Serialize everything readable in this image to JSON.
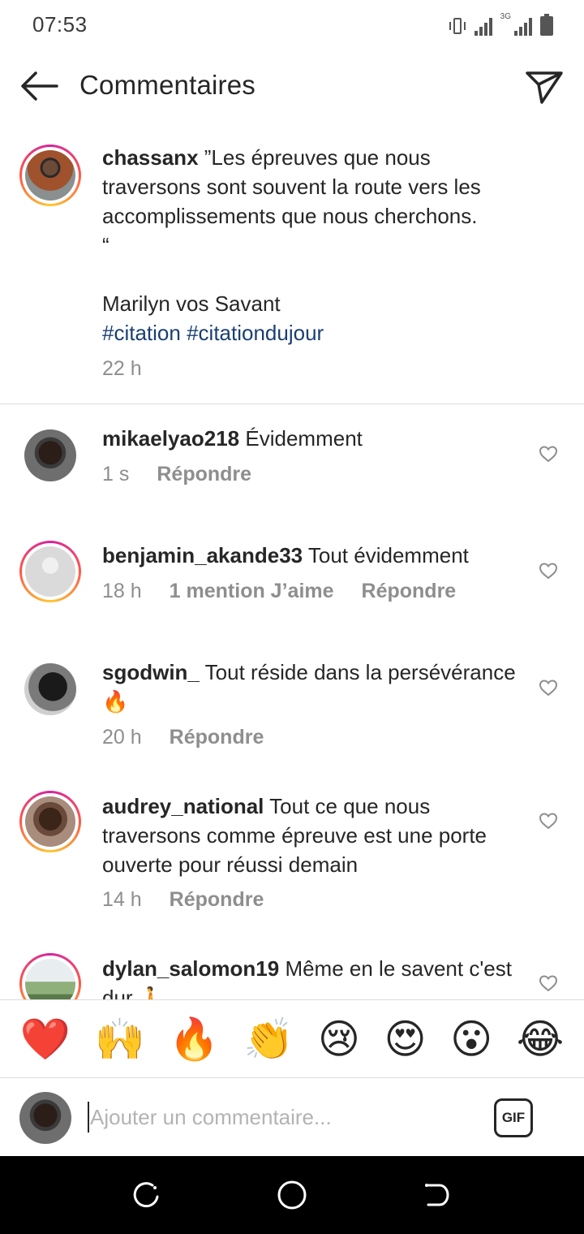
{
  "status_bar": {
    "time": "07:53",
    "network": "3G"
  },
  "header": {
    "title": "Commentaires",
    "back_icon": "arrow-left-icon",
    "send_icon": "paper-plane-icon"
  },
  "caption": {
    "username": "chassanx",
    "line1": "”Les épreuves que nous traversons sont souvent la route vers les accomplissements que nous cherchons.",
    "line2": "“",
    "author": "Marilyn vos Savant",
    "hashtags": [
      "#citation",
      "#citationdujour"
    ],
    "time": "22 h"
  },
  "comments": [
    {
      "username": "mikaelyao218",
      "text": "Évidemment",
      "time": "1 s",
      "likes": "",
      "reply": "Répondre",
      "ring": false
    },
    {
      "username": "benjamin_akande33",
      "text": "Tout évidemment",
      "time": "18 h",
      "likes": "1 mention J’aime",
      "reply": "Répondre",
      "ring": true
    },
    {
      "username": "sgodwin_",
      "text": "Tout réside dans la persévérance 🔥",
      "time": "20 h",
      "likes": "",
      "reply": "Répondre",
      "ring": false
    },
    {
      "username": "audrey_national",
      "text": "Tout ce que nous traversons comme épreuve est une porte ouverte pour réussi demain",
      "time": "14 h",
      "likes": "",
      "reply": "Répondre",
      "ring": true
    },
    {
      "username": "dylan_salomon19",
      "text": "Même en le savent c'est dur 🚶",
      "time": "",
      "likes": "",
      "reply": "",
      "ring": true
    }
  ],
  "emoji_bar": [
    "❤️",
    "🙌",
    "🔥",
    "👏",
    "😢",
    "😍",
    "😮",
    "😂"
  ],
  "composer": {
    "placeholder": "Ajouter un commentaire...",
    "gif_label": "GIF"
  },
  "colors": {
    "link": "#1a3f72",
    "muted": "#8e8e8e",
    "text": "#262626",
    "divider": "#dbdbdb"
  }
}
